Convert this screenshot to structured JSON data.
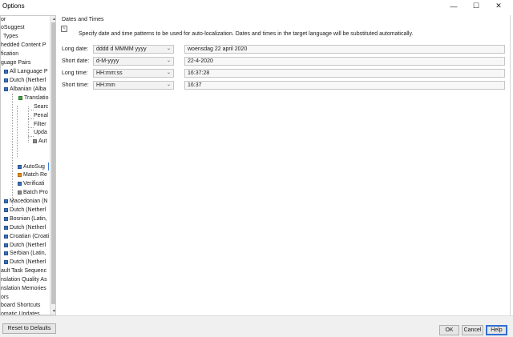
{
  "window": {
    "title": "Options",
    "minimize_glyph": "—",
    "maximize_glyph": "☐",
    "close_glyph": "✕"
  },
  "tree": {
    "items": [
      {
        "label": "or",
        "icon": ""
      },
      {
        "label": "oSuggest",
        "icon": ""
      },
      {
        "label": "Types",
        "icon": ""
      },
      {
        "label": "hedded Content P",
        "icon": ""
      },
      {
        "label": "fication",
        "icon": ""
      },
      {
        "label": "guage Pairs",
        "icon": ""
      },
      {
        "label": "All Language P",
        "icon": "language-pair-icon"
      },
      {
        "label": "Dutch (Netherl",
        "icon": "language-pair-icon"
      },
      {
        "label": "Albanian (Alba",
        "icon": "language-pair-icon"
      },
      {
        "label": "Translatio",
        "icon": "translation-memory-icon"
      },
      {
        "label": "Searc",
        "icon": ""
      },
      {
        "label": "Penal",
        "icon": ""
      },
      {
        "label": "Filter",
        "icon": ""
      },
      {
        "label": "Upda",
        "icon": ""
      },
      {
        "label": "Aut",
        "icon": "gear-icon"
      },
      {
        "label": "AutoSug",
        "icon": "autosuggest-icon"
      },
      {
        "label": "Match Re",
        "icon": "match-repair-icon"
      },
      {
        "label": "Verificati",
        "icon": "verification-icon"
      },
      {
        "label": "Batch Pro",
        "icon": "batch-processing-icon"
      },
      {
        "label": "Macedonian (N",
        "icon": "language-pair-icon"
      },
      {
        "label": "Dutch (Netherl",
        "icon": "language-pair-icon"
      },
      {
        "label": "Bosnian (Latin,",
        "icon": "language-pair-icon"
      },
      {
        "label": "Dutch (Netherl",
        "icon": "language-pair-icon"
      },
      {
        "label": "Croatian (Croati",
        "icon": "language-pair-icon"
      },
      {
        "label": "Dutch (Netherl",
        "icon": "language-pair-icon"
      },
      {
        "label": "Serbian (Latin,",
        "icon": "language-pair-icon"
      },
      {
        "label": "Dutch (Netherl",
        "icon": "language-pair-icon"
      },
      {
        "label": "ault Task Sequenc",
        "icon": ""
      },
      {
        "label": "nslation Quality As",
        "icon": ""
      },
      {
        "label": "nslation Memories",
        "icon": ""
      },
      {
        "label": "ors",
        "icon": ""
      },
      {
        "label": "board Shortcuts",
        "icon": ""
      },
      {
        "label": "omatic Updates",
        "icon": ""
      }
    ],
    "scroll_up_glyph": "▲",
    "scroll_down_glyph": "▼"
  },
  "main": {
    "section_title": "Dates and Times",
    "description": "Specify date and time patterns to be used for auto-localization. Dates and times in the target language will be substituted automatically.",
    "info_icon_glyph": "✎",
    "rows": [
      {
        "label": "Long date:",
        "pattern": "dddd d MMMM yyyy",
        "preview": "woensdag 22 april 2020"
      },
      {
        "label": "Short date:",
        "pattern": "d-M-yyyy",
        "preview": "22-4-2020"
      },
      {
        "label": "Long time:",
        "pattern": "HH:mm:ss",
        "preview": "16:37:28"
      },
      {
        "label": "Short time:",
        "pattern": "HH:mm",
        "preview": "16:37"
      }
    ],
    "dropdown_glyph": "⌄"
  },
  "footer": {
    "reset_label": "Reset to Defaults",
    "ok_label": "OK",
    "cancel_label": "Cancel",
    "help_label": "Help"
  }
}
